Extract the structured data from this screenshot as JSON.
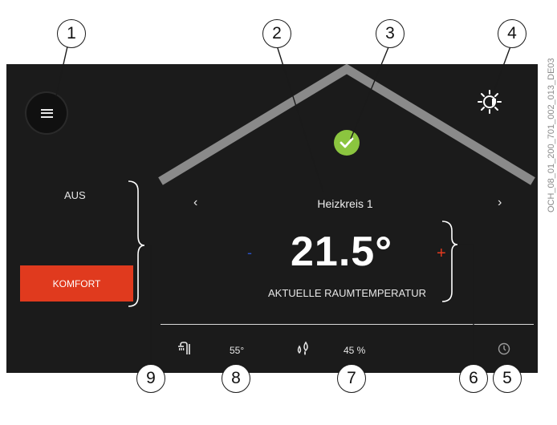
{
  "screen": {
    "menu_icon": "menu-icon",
    "status_icon": "check-icon",
    "weather_icon": "sun-icon",
    "mode_off_label": "AUS",
    "mode_comfort_label": "KOMFORT",
    "circuit_name": "Heizkreis 1",
    "prev_arrow": "‹",
    "next_arrow": "›",
    "minus_label": "-",
    "plus_label": "+",
    "temperature": "21.5°",
    "temperature_caption": "AKTUELLE RAUMTEMPERATUR",
    "hot_water_temp": "55°",
    "humidity": "45 %",
    "colors": {
      "background": "#1b1b1b",
      "comfort": "#e03a1e",
      "ok": "#8bc53f",
      "minus": "#2b53c9",
      "plus": "#e53a1f"
    }
  },
  "callouts": [
    "1",
    "2",
    "3",
    "4",
    "5",
    "6",
    "7",
    "8",
    "9"
  ],
  "document_code": "OCH_08_01_200_701_002_013_DE03"
}
